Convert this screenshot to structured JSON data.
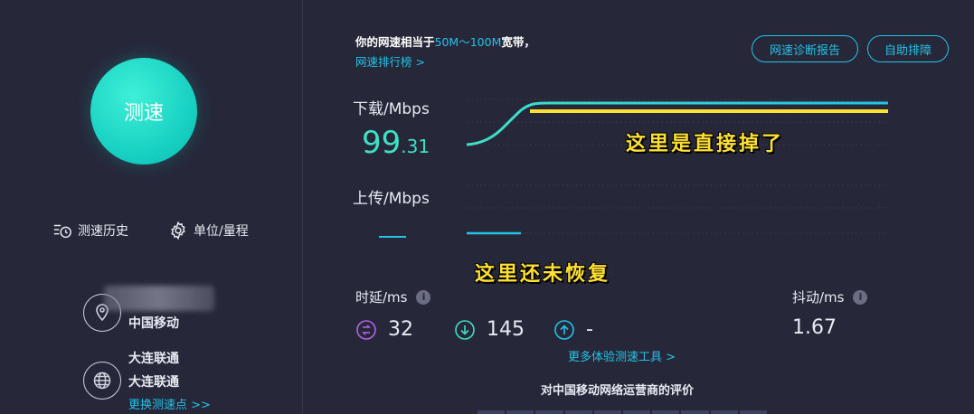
{
  "left": {
    "speed_button_label": "测速",
    "tools": {
      "history_label": "测速历史",
      "unit_label": "单位/量程"
    },
    "isp": {
      "name": "中国移动"
    },
    "server": {
      "line1": "大连联通",
      "line2": "大连联通",
      "change_link": "更换测速点 >>"
    }
  },
  "header": {
    "equiv_prefix": "你的网速相当于",
    "equiv_range": "50M～100M",
    "equiv_suffix": "宽带，",
    "rank_link": "网速排行榜 >",
    "diagnose_button": "网速诊断报告",
    "self_check_button": "自助排障"
  },
  "download": {
    "label": "下载/Mbps",
    "value_int": "99",
    "value_dec": ".31"
  },
  "upload": {
    "label": "上传/Mbps"
  },
  "annotations": {
    "download_note": "这里是直接掉了",
    "upload_note": "这里还未恢复"
  },
  "latency": {
    "label": "时延/ms",
    "ping": "32",
    "down": "145",
    "up": "-"
  },
  "jitter": {
    "label": "抖动/ms",
    "value": "1.67"
  },
  "more_tools_link": "更多体验测速工具 >",
  "rating_title": "对中国移动网络运营商的评价",
  "colors": {
    "background": "#26283a",
    "accent": "#23c3e6",
    "speed_green": "#3fe0c4",
    "annotation_yellow": "#ffe033"
  },
  "info_icon_glyph": "i"
}
